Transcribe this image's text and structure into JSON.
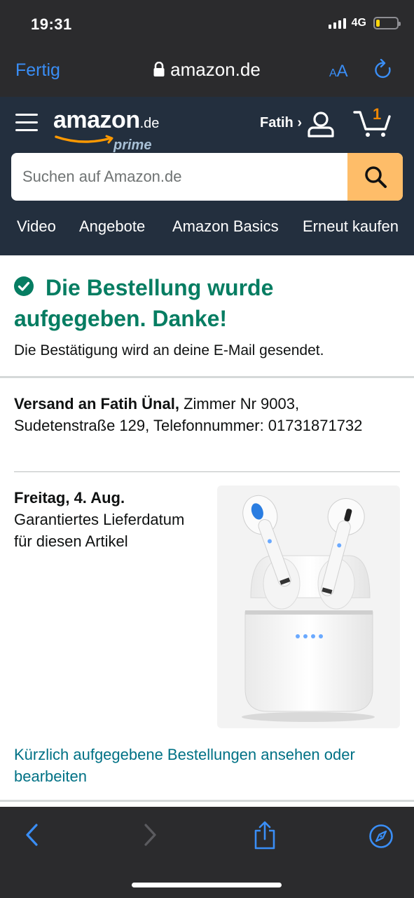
{
  "status_bar": {
    "time": "19:31",
    "network": "4G",
    "battery_level_fraction": 0.15,
    "battery_color": "#ffd60a"
  },
  "browser": {
    "done_label": "Fertig",
    "url": "amazon.de",
    "text_size_label_small": "A",
    "text_size_label_large": "A",
    "lock_icon": "lock-icon",
    "reload_icon": "reload-icon"
  },
  "amazon_header": {
    "logo_text": "amazon",
    "logo_tld": ".de",
    "logo_prime": "prime",
    "account_label": "Fatih ›",
    "cart_count": "1",
    "search_placeholder": "Suchen auf Amazon.de",
    "nav_links": [
      "Video",
      "Angebote",
      "Amazon Basics",
      "Erneut kaufen"
    ]
  },
  "confirmation": {
    "title": "Die Bestellung wurde aufgegeben. Danke!",
    "subtitle": "Die Bestätigung wird an deine E-Mail gesendet."
  },
  "shipping": {
    "label": "Versand an Fatih Ünal,",
    "address": "Zimmer Nr 9003, Sudetenstraße 129, Telefonnummer: 01731871732"
  },
  "delivery": {
    "date": "Freitag, 4. Aug.",
    "note": "Garantiertes Lieferdatum für diesen Artikel"
  },
  "orders_link": "Kürzlich aufgegebene Bestellungen ansehen oder bearbeiten",
  "colors": {
    "status_bar_bg": "#2b2b2d",
    "header_bg": "#232f3e",
    "search_button": "#febd69",
    "success_green": "#067d62",
    "link_teal": "#007185",
    "ios_blue": "#3a8ef6",
    "cart_orange": "#f08804"
  }
}
